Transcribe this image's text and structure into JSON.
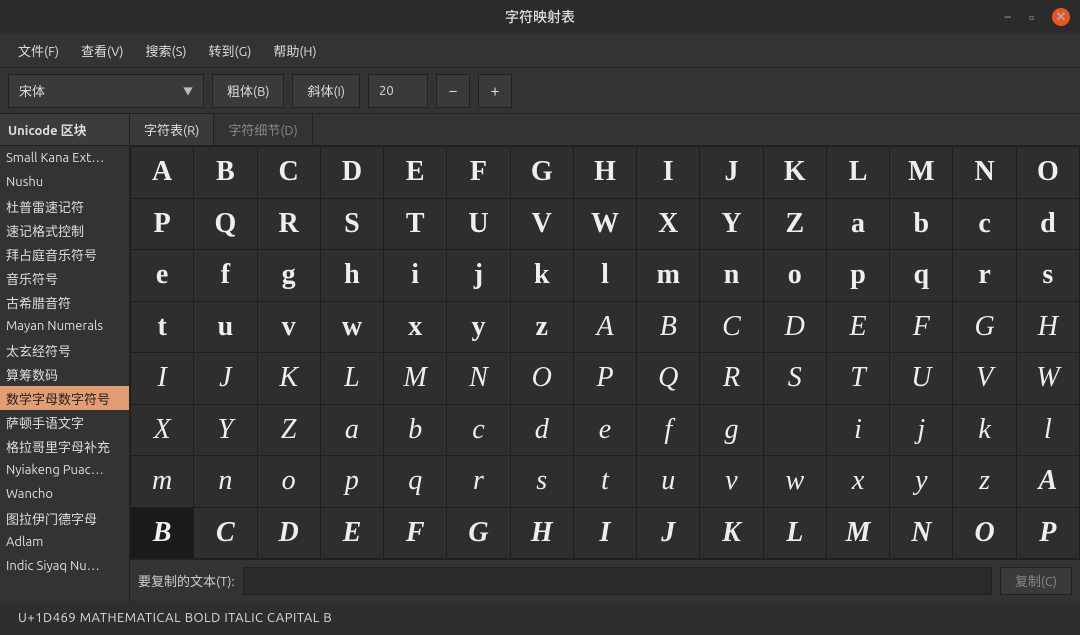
{
  "window": {
    "title": "字符映射表"
  },
  "menubar": [
    "文件(F)",
    "查看(V)",
    "搜索(S)",
    "转到(G)",
    "帮助(H)"
  ],
  "toolbar": {
    "font": "宋体",
    "bold": "粗体(B)",
    "italic": "斜体(I)",
    "size": "20",
    "minus": "−",
    "plus": "+"
  },
  "left": {
    "header": "Unicode 区块",
    "items": [
      "Small Kana Ext…",
      "Nushu",
      "杜普雷速记符",
      "速记格式控制",
      "拜占庭音乐符号",
      "音乐符号",
      "古希腊音符",
      "Mayan Numerals",
      "太玄经符号",
      "算筹数码",
      "数学字母数字符号",
      "萨顿手语文字",
      "格拉哥里字母补充",
      "Nyiakeng Puac…",
      "Wancho",
      "图拉伊门德字母",
      "Adlam",
      "Indic Siyaq Nu…"
    ],
    "selected_index": 10
  },
  "tabs": {
    "items": [
      "字符表(R)",
      "字符细节(D)"
    ],
    "active_index": 0
  },
  "chars": {
    "cols": 15,
    "rows": 8,
    "selected_index": 105,
    "cells": [
      {
        "t": "A",
        "s": "font-weight:bold"
      },
      {
        "t": "B",
        "s": "font-weight:bold"
      },
      {
        "t": "C",
        "s": "font-weight:bold"
      },
      {
        "t": "D",
        "s": "font-weight:bold"
      },
      {
        "t": "E",
        "s": "font-weight:bold"
      },
      {
        "t": "F",
        "s": "font-weight:bold"
      },
      {
        "t": "G",
        "s": "font-weight:bold"
      },
      {
        "t": "H",
        "s": "font-weight:bold"
      },
      {
        "t": "I",
        "s": "font-weight:bold"
      },
      {
        "t": "J",
        "s": "font-weight:bold"
      },
      {
        "t": "K",
        "s": "font-weight:bold"
      },
      {
        "t": "L",
        "s": "font-weight:bold"
      },
      {
        "t": "M",
        "s": "font-weight:bold"
      },
      {
        "t": "N",
        "s": "font-weight:bold"
      },
      {
        "t": "O",
        "s": "font-weight:bold"
      },
      {
        "t": "P",
        "s": "font-weight:bold"
      },
      {
        "t": "Q",
        "s": "font-weight:bold"
      },
      {
        "t": "R",
        "s": "font-weight:bold"
      },
      {
        "t": "S",
        "s": "font-weight:bold"
      },
      {
        "t": "T",
        "s": "font-weight:bold"
      },
      {
        "t": "U",
        "s": "font-weight:bold"
      },
      {
        "t": "V",
        "s": "font-weight:bold"
      },
      {
        "t": "W",
        "s": "font-weight:bold"
      },
      {
        "t": "X",
        "s": "font-weight:bold"
      },
      {
        "t": "Y",
        "s": "font-weight:bold"
      },
      {
        "t": "Z",
        "s": "font-weight:bold"
      },
      {
        "t": "a",
        "s": "font-weight:bold"
      },
      {
        "t": "b",
        "s": "font-weight:bold"
      },
      {
        "t": "c",
        "s": "font-weight:bold"
      },
      {
        "t": "d",
        "s": "font-weight:bold"
      },
      {
        "t": "e",
        "s": "font-weight:bold"
      },
      {
        "t": "f",
        "s": "font-weight:bold"
      },
      {
        "t": "g",
        "s": "font-weight:bold"
      },
      {
        "t": "h",
        "s": "font-weight:bold"
      },
      {
        "t": "i",
        "s": "font-weight:bold"
      },
      {
        "t": "j",
        "s": "font-weight:bold"
      },
      {
        "t": "k",
        "s": "font-weight:bold"
      },
      {
        "t": "l",
        "s": "font-weight:bold"
      },
      {
        "t": "m",
        "s": "font-weight:bold"
      },
      {
        "t": "n",
        "s": "font-weight:bold"
      },
      {
        "t": "o",
        "s": "font-weight:bold"
      },
      {
        "t": "p",
        "s": "font-weight:bold"
      },
      {
        "t": "q",
        "s": "font-weight:bold"
      },
      {
        "t": "r",
        "s": "font-weight:bold"
      },
      {
        "t": "s",
        "s": "font-weight:bold"
      },
      {
        "t": "t",
        "s": "font-weight:bold"
      },
      {
        "t": "u",
        "s": "font-weight:bold"
      },
      {
        "t": "v",
        "s": "font-weight:bold"
      },
      {
        "t": "w",
        "s": "font-weight:bold"
      },
      {
        "t": "x",
        "s": "font-weight:bold"
      },
      {
        "t": "y",
        "s": "font-weight:bold"
      },
      {
        "t": "z",
        "s": "font-weight:bold"
      },
      {
        "t": "A",
        "s": "font-style:italic"
      },
      {
        "t": "B",
        "s": "font-style:italic"
      },
      {
        "t": "C",
        "s": "font-style:italic"
      },
      {
        "t": "D",
        "s": "font-style:italic"
      },
      {
        "t": "E",
        "s": "font-style:italic"
      },
      {
        "t": "F",
        "s": "font-style:italic"
      },
      {
        "t": "G",
        "s": "font-style:italic"
      },
      {
        "t": "H",
        "s": "font-style:italic"
      },
      {
        "t": "I",
        "s": "font-style:italic"
      },
      {
        "t": "J",
        "s": "font-style:italic"
      },
      {
        "t": "K",
        "s": "font-style:italic"
      },
      {
        "t": "L",
        "s": "font-style:italic"
      },
      {
        "t": "M",
        "s": "font-style:italic"
      },
      {
        "t": "N",
        "s": "font-style:italic"
      },
      {
        "t": "O",
        "s": "font-style:italic"
      },
      {
        "t": "P",
        "s": "font-style:italic"
      },
      {
        "t": "Q",
        "s": "font-style:italic"
      },
      {
        "t": "R",
        "s": "font-style:italic"
      },
      {
        "t": "S",
        "s": "font-style:italic"
      },
      {
        "t": "T",
        "s": "font-style:italic"
      },
      {
        "t": "U",
        "s": "font-style:italic"
      },
      {
        "t": "V",
        "s": "font-style:italic"
      },
      {
        "t": "W",
        "s": "font-style:italic"
      },
      {
        "t": "X",
        "s": "font-style:italic"
      },
      {
        "t": "Y",
        "s": "font-style:italic"
      },
      {
        "t": "Z",
        "s": "font-style:italic"
      },
      {
        "t": "a",
        "s": "font-style:italic"
      },
      {
        "t": "b",
        "s": "font-style:italic"
      },
      {
        "t": "c",
        "s": "font-style:italic"
      },
      {
        "t": "d",
        "s": "font-style:italic"
      },
      {
        "t": "e",
        "s": "font-style:italic"
      },
      {
        "t": "f",
        "s": "font-style:italic"
      },
      {
        "t": "g",
        "s": "font-style:italic"
      },
      {
        "t": "",
        "s": ""
      },
      {
        "t": "i",
        "s": "font-style:italic"
      },
      {
        "t": "j",
        "s": "font-style:italic"
      },
      {
        "t": "k",
        "s": "font-style:italic"
      },
      {
        "t": "l",
        "s": "font-style:italic"
      },
      {
        "t": "m",
        "s": "font-style:italic"
      },
      {
        "t": "n",
        "s": "font-style:italic"
      },
      {
        "t": "o",
        "s": "font-style:italic"
      },
      {
        "t": "p",
        "s": "font-style:italic"
      },
      {
        "t": "q",
        "s": "font-style:italic"
      },
      {
        "t": "r",
        "s": "font-style:italic"
      },
      {
        "t": "s",
        "s": "font-style:italic"
      },
      {
        "t": "t",
        "s": "font-style:italic"
      },
      {
        "t": "u",
        "s": "font-style:italic"
      },
      {
        "t": "v",
        "s": "font-style:italic"
      },
      {
        "t": "w",
        "s": "font-style:italic"
      },
      {
        "t": "x",
        "s": "font-style:italic"
      },
      {
        "t": "y",
        "s": "font-style:italic"
      },
      {
        "t": "z",
        "s": "font-style:italic"
      },
      {
        "t": "A",
        "s": "font-weight:bold;font-style:italic"
      },
      {
        "t": "B",
        "s": "font-weight:bold;font-style:italic"
      },
      {
        "t": "C",
        "s": "font-weight:bold;font-style:italic"
      },
      {
        "t": "D",
        "s": "font-weight:bold;font-style:italic"
      },
      {
        "t": "E",
        "s": "font-weight:bold;font-style:italic"
      },
      {
        "t": "F",
        "s": "font-weight:bold;font-style:italic"
      },
      {
        "t": "G",
        "s": "font-weight:bold;font-style:italic"
      },
      {
        "t": "H",
        "s": "font-weight:bold;font-style:italic"
      },
      {
        "t": "I",
        "s": "font-weight:bold;font-style:italic"
      },
      {
        "t": "J",
        "s": "font-weight:bold;font-style:italic"
      },
      {
        "t": "K",
        "s": "font-weight:bold;font-style:italic"
      },
      {
        "t": "L",
        "s": "font-weight:bold;font-style:italic"
      },
      {
        "t": "M",
        "s": "font-weight:bold;font-style:italic"
      },
      {
        "t": "N",
        "s": "font-weight:bold;font-style:italic"
      },
      {
        "t": "O",
        "s": "font-weight:bold;font-style:italic"
      },
      {
        "t": "P",
        "s": "font-weight:bold;font-style:italic"
      }
    ]
  },
  "bottom": {
    "label": "要复制的文本(T):",
    "copy_btn": "复制(C)"
  },
  "status": "U+1D469 MATHEMATICAL BOLD ITALIC CAPITAL B"
}
